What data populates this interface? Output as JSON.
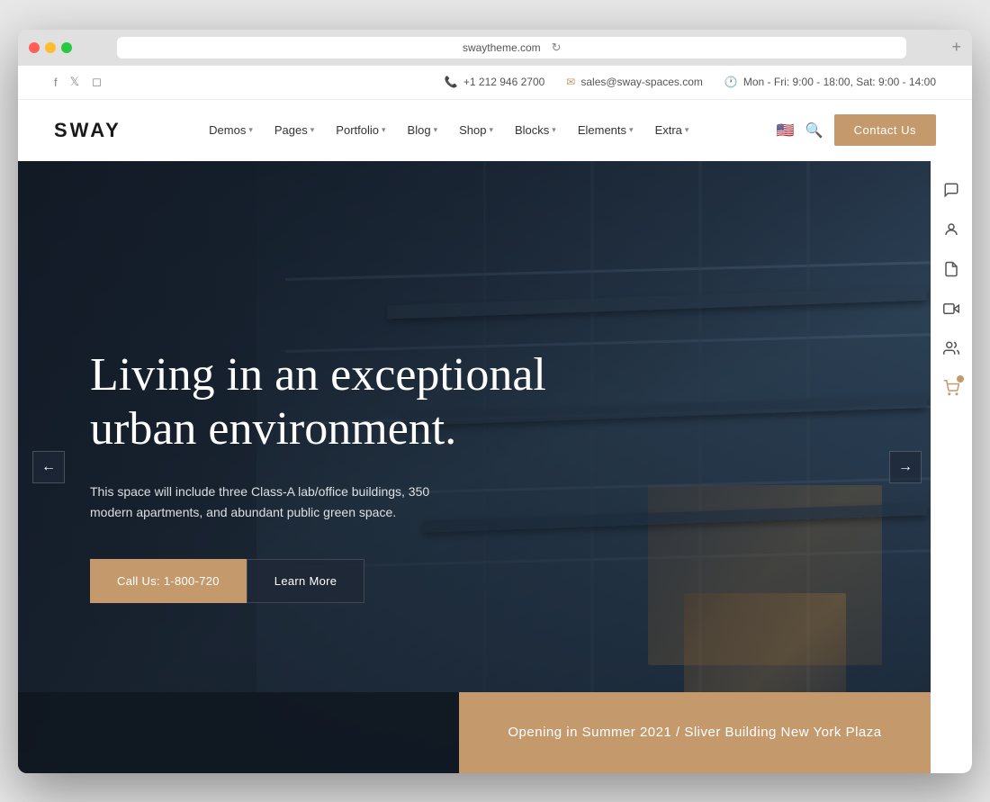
{
  "browser": {
    "url": "swaytheme.com",
    "new_tab_label": "+"
  },
  "topbar": {
    "phone": "+1 212 946 2700",
    "email": "sales@sway-spaces.com",
    "hours": "Mon - Fri: 9:00 - 18:00, Sat: 9:00 - 14:00"
  },
  "nav": {
    "logo": "SWAY",
    "items": [
      {
        "label": "Demos",
        "has_dropdown": true
      },
      {
        "label": "Pages",
        "has_dropdown": true
      },
      {
        "label": "Portfolio",
        "has_dropdown": true
      },
      {
        "label": "Blog",
        "has_dropdown": true
      },
      {
        "label": "Shop",
        "has_dropdown": true
      },
      {
        "label": "Blocks",
        "has_dropdown": true
      },
      {
        "label": "Elements",
        "has_dropdown": true
      },
      {
        "label": "Extra",
        "has_dropdown": true
      }
    ],
    "contact_btn": "Contact Us"
  },
  "hero": {
    "title": "Living in an exceptional urban environment.",
    "subtitle": "This space will include three Class-A lab/office buildings, 350 modern apartments, and abundant public green space.",
    "btn_call": "Call Us: 1-800-720",
    "btn_learn": "Learn More",
    "arrow_left": "←",
    "arrow_right": "→"
  },
  "right_sidebar": {
    "icons": [
      "💬",
      "👤",
      "📄",
      "🎥",
      "👥",
      "🛒"
    ]
  },
  "bottom_banner": {
    "text": "Opening in Summer 2021 / Sliver Building New York Plaza"
  }
}
